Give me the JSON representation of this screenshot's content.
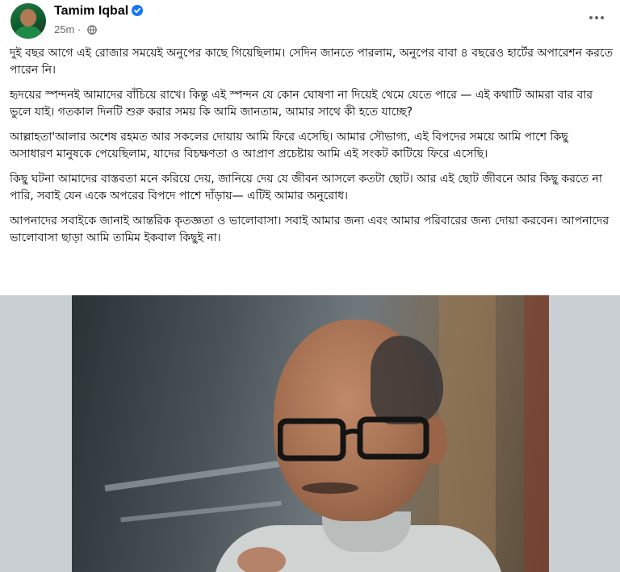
{
  "post": {
    "author": "Tamim Iqbal",
    "time": "25m",
    "separator": "·",
    "paragraphs": [
      "দুই বছর আগে এই রোজার সময়েই অনুপের কাছে গিয়েছিলাম। সেদিন জানতে পারলাম, অনুপের বাবা ৪ বছরেও হার্টের অপারেশন করতে পারেন নি।",
      "হৃদয়ের স্পন্দনই আমাদের বাঁচিয়ে রাখে। কিন্তু এই স্পন্দন যে কোন ঘোষণা না দিয়েই থেমে যেতে পারে — এই কথাটি আমরা বার বার ভুলে যাই। গতকাল দিনটি শুরু করার সময় কি আমি জানতাম, আমার সাথে কী হতে যাচ্ছে?",
      "আল্লাহতা'আলার অশেষ রহমত আর সকলের দোয়ায় আমি ফিরে এসেছি। আমার সৌভাগ্য, এই বিপদের সময়ে আমি পাশে কিছু অসাধারণ মানুষকে পেয়েছিলাম, যাদের বিচক্ষণতা ও আপ্রাণ প্রচেষ্টায় আমি এই সংকট কাটিয়ে ফিরে এসেছি।",
      "কিছু ঘটনা আমাদের বাস্তবতা মনে করিয়ে দেয়, জানিয়ে দেয় যে জীবন আসলে কতটা ছোট। আর এই ছোট জীবনে আর কিছু করতে না পারি, সবাই যেন একে অপরের বিপদে পাশে দাঁড়ায়— এটিই আমার অনুরোধ।",
      "আপনাদের সবাইকে জানাই আন্তরিক কৃতজ্ঞতা ও ভালোবাসা। সবাই আমার জন্য এবং আমার পরিবারের জন্য দোয়া করবেন। আপনাদের ভালোবাসা ছাড়া আমি তামিম ইকবাল কিছুই না।"
    ]
  },
  "icons": {
    "verified": "verified-badge-icon",
    "audience": "globe-icon",
    "more": "more-options-icon"
  },
  "colors": {
    "verified": "#1877f2",
    "meta_text": "#65676b",
    "text": "#050505"
  }
}
